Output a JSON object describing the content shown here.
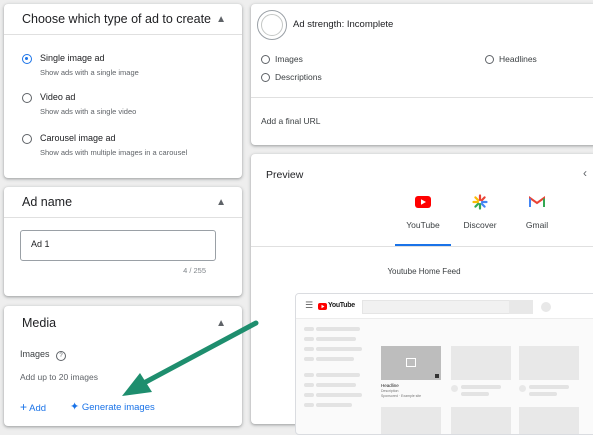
{
  "ad_type": {
    "title": "Choose which type of ad to create",
    "options": [
      {
        "label": "Single image ad",
        "description": "Show ads with a single image",
        "selected": true
      },
      {
        "label": "Video ad",
        "description": "Show ads with a single video",
        "selected": false
      },
      {
        "label": "Carousel image ad",
        "description": "Show ads with multiple images in a carousel",
        "selected": false
      }
    ]
  },
  "ad_name": {
    "title": "Ad name",
    "value": "Ad 1",
    "counter": "4 / 255"
  },
  "media": {
    "title": "Media",
    "images_label": "Images",
    "hint": "Add up to 20 images",
    "add_label": "Add",
    "generate_label": "Generate images"
  },
  "strength": {
    "title": "Ad strength: Incomplete",
    "items": [
      "Images",
      "Headlines",
      "Descriptions"
    ],
    "final_url": "Add a final URL"
  },
  "preview": {
    "title": "Preview",
    "tabs": [
      {
        "label": "YouTube",
        "active": true,
        "icon": "youtube-icon"
      },
      {
        "label": "Discover",
        "active": false,
        "icon": "discover-icon"
      },
      {
        "label": "Gmail",
        "active": false,
        "icon": "gmail-icon"
      }
    ],
    "feed_label": "Youtube Home Feed",
    "mock_logo": "YouTube",
    "mock_title": "Headline",
    "mock_desc": "Description",
    "mock_url": "Sponsored · Example site"
  },
  "colors": {
    "accent": "#1a73e8",
    "arrow": "#1e8e6e",
    "youtube_red": "#ff0000"
  }
}
